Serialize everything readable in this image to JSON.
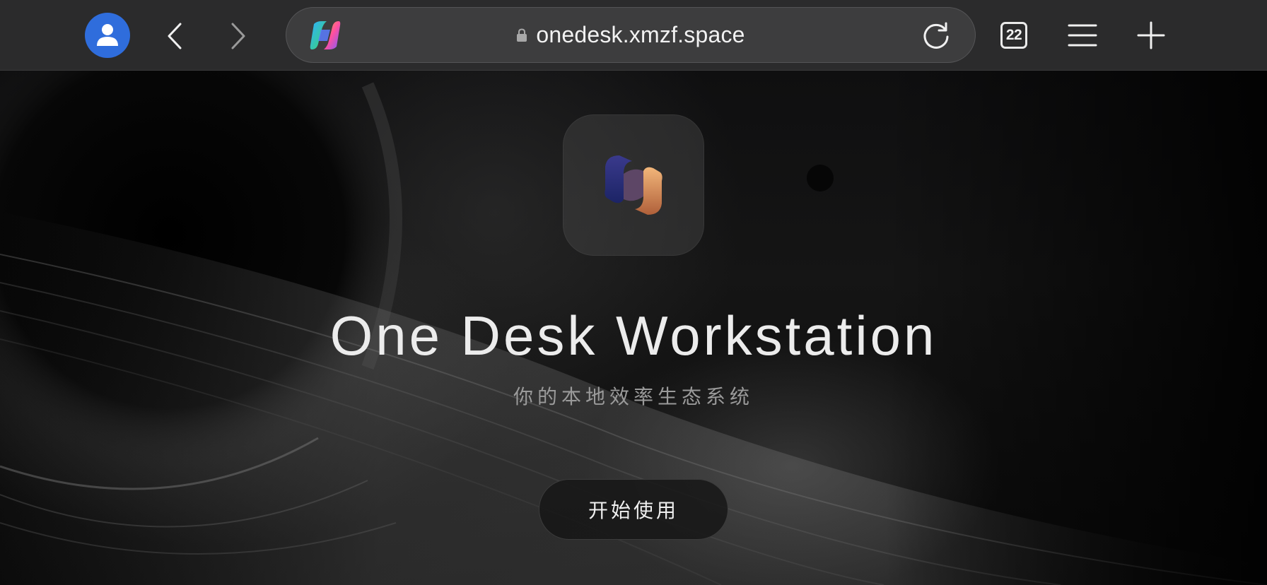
{
  "browser": {
    "url": "onedesk.xmzf.space",
    "tab_count": "22",
    "icons": {
      "profile": "person-icon",
      "back": "chevron-left-icon",
      "forward": "chevron-right-icon",
      "assistant": "copilot-icon",
      "secure": "lock-icon",
      "reload": "reload-icon",
      "tabs": "tabs-icon",
      "menu": "hamburger-menu-icon",
      "new_tab": "plus-icon"
    },
    "colors": {
      "toolbar_bg": "#2b2b2c",
      "avatar_bg": "#2f6ddc"
    }
  },
  "page": {
    "logo": "one-desk-logo-icon",
    "title": "One Desk Workstation",
    "subtitle": "你的本地效率生态系统",
    "cta_label": "开始使用",
    "colors": {
      "background": "#0f0f10",
      "title": "#ececec",
      "subtitle": "#9a9a9a"
    }
  }
}
